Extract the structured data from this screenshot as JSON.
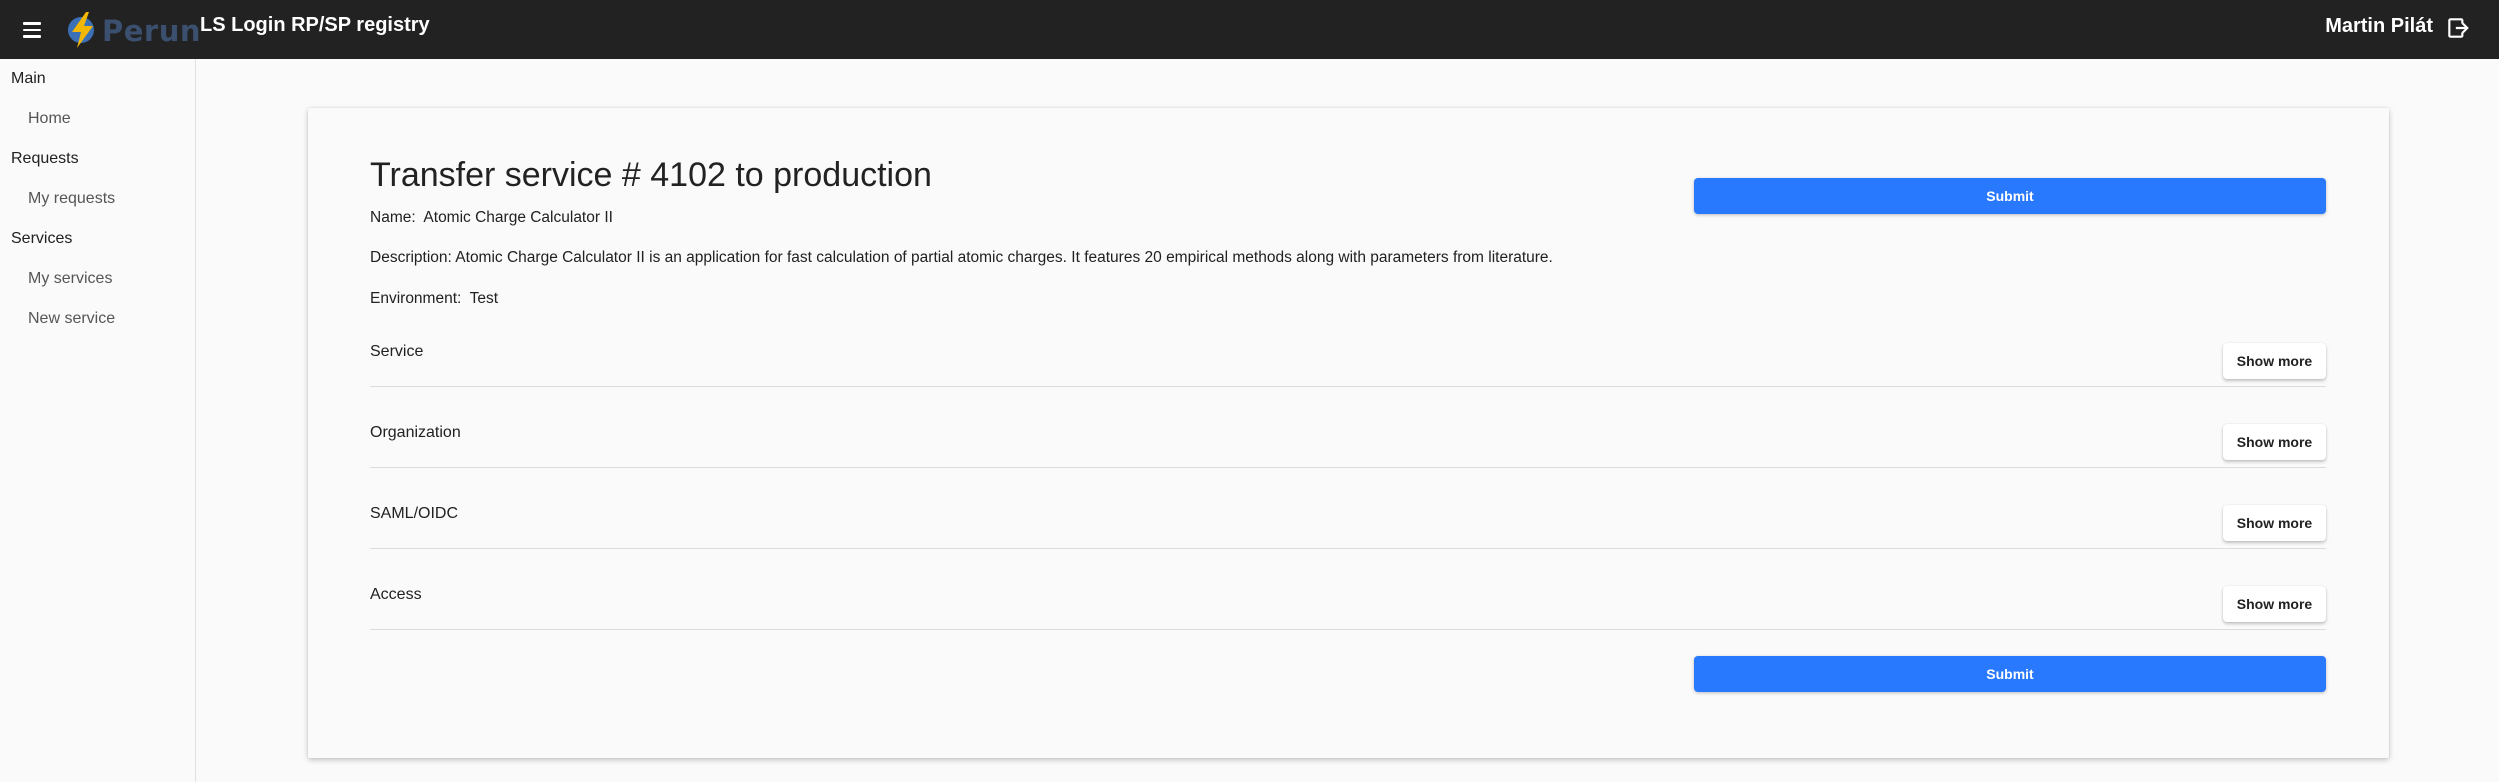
{
  "header": {
    "logo_text": "Perun",
    "app_title": "LS Login RP/SP registry",
    "user_name": "Martin Pilát"
  },
  "sidebar": {
    "groups": [
      {
        "label": "Main",
        "items": [
          {
            "label": "Home"
          }
        ]
      },
      {
        "label": "Requests",
        "items": [
          {
            "label": "My requests"
          }
        ]
      },
      {
        "label": "Services",
        "items": [
          {
            "label": "My services"
          },
          {
            "label": "New service"
          }
        ]
      }
    ]
  },
  "main": {
    "title": "Transfer service # 4102 to production",
    "name_label": "Name:",
    "name_value": "Atomic Charge Calculator II",
    "description_label": "Description:",
    "description_value": "Atomic Charge Calculator II is an application for fast calculation of partial atomic charges. It features 20 empirical methods along with parameters from literature.",
    "environment_label": "Environment:",
    "environment_value": "Test",
    "submit_label": "Submit",
    "show_more_label": "Show more",
    "sections": [
      {
        "label": "Service"
      },
      {
        "label": "Organization"
      },
      {
        "label": "SAML/OIDC"
      },
      {
        "label": "Access"
      }
    ]
  },
  "colors": {
    "topbar": "#222222",
    "accent": "#2979ff",
    "logo_bolt_yellow": "#f2b705",
    "logo_bolt_blue": "#3b6fb6"
  }
}
